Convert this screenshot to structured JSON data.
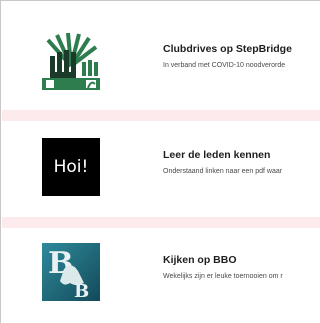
{
  "items": [
    {
      "title": "Clubdrives op StepBridge",
      "description": "In verband met COVID-10 noodverorde",
      "icon": "stepbridge-logo-icon"
    },
    {
      "title": "Leer de leden kennen",
      "description": "Onderstaand linken naar een pdf waar",
      "icon": "hoi-speech-icon",
      "icon_text": "Hoi!"
    },
    {
      "title": "Kijken op BBO",
      "description": "Wekelijks zijn er leuke toernooien om r",
      "icon": "bbo-logo-icon"
    }
  ],
  "colors": {
    "separator": "#fdeaec",
    "stepbridge_green": "#2e7d4f",
    "bbo_teal": "#1f6a7c"
  }
}
